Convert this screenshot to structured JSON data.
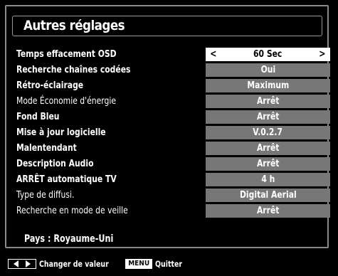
{
  "menu": {
    "title": "Autres réglages",
    "items": [
      {
        "label": "Temps effacement OSD",
        "value": "60 Sec"
      },
      {
        "label": "Recherche chaînes codées",
        "value": "Oui"
      },
      {
        "label": "Rétro-éclairage",
        "value": "Maximum"
      },
      {
        "label": "Mode Économie d'énergie",
        "value": "Arrêt"
      },
      {
        "label": "Fond Bleu",
        "value": "Arrêt"
      },
      {
        "label": "Mise à jour logicielle",
        "value": "V.0.2.7"
      },
      {
        "label": "Malentendant",
        "value": "Arrêt"
      },
      {
        "label": "Description Audio",
        "value": "Arrêt"
      },
      {
        "label": "ARRÊT automatique TV",
        "value": "4 h"
      },
      {
        "label": "Type de diffusi.",
        "value": "Digital Aerial"
      },
      {
        "label": "Recherche en mode de veille",
        "value": "Arrêt"
      }
    ],
    "selected_index": 0,
    "arrow_left": "<",
    "arrow_right": ">"
  },
  "country": "Pays : Royaume-Uni",
  "help": {
    "change_label": "Changer de valeur",
    "menu_key": "MENU",
    "quit_label": "Quitter"
  }
}
